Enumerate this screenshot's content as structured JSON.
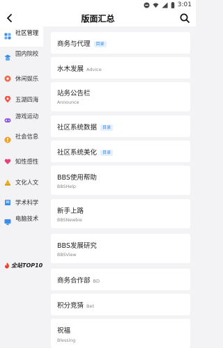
{
  "status_bar": {
    "time": "3:01"
  },
  "header": {
    "title": "版面汇总"
  },
  "sidebar": {
    "items": [
      {
        "label": "社区管理",
        "active": true
      },
      {
        "label": "国内院校"
      },
      {
        "label": "休闲娱乐"
      },
      {
        "label": "五湖四海"
      },
      {
        "label": "游戏运动"
      },
      {
        "label": "社会信息"
      },
      {
        "label": "知性感性"
      },
      {
        "label": "文化人文"
      },
      {
        "label": "学术科学"
      },
      {
        "label": "电脑技术"
      }
    ],
    "top10_label": "全站TOP10"
  },
  "boards": [
    {
      "title": "商务与代理",
      "tag": "目录"
    },
    {
      "title": "水木发展",
      "subtitle": "Advice"
    },
    {
      "title": "站务公告栏",
      "subtitle": "Announce"
    },
    {
      "title": "社区系统数据",
      "tag": "目录"
    },
    {
      "title": "社区系统美化",
      "tag": "目录"
    },
    {
      "title": "BBS使用帮助",
      "subtitle": "BBSHelp"
    },
    {
      "title": "新手上路",
      "subtitle": "BBSNewbie"
    },
    {
      "title": "BBS发展研究",
      "subtitle": "BBSView"
    },
    {
      "title": "商务合作部",
      "subtitle": "BD"
    },
    {
      "title": "积分竞猜",
      "subtitle": "Bet"
    },
    {
      "title": "祝福",
      "subtitle": "Blessing"
    }
  ]
}
